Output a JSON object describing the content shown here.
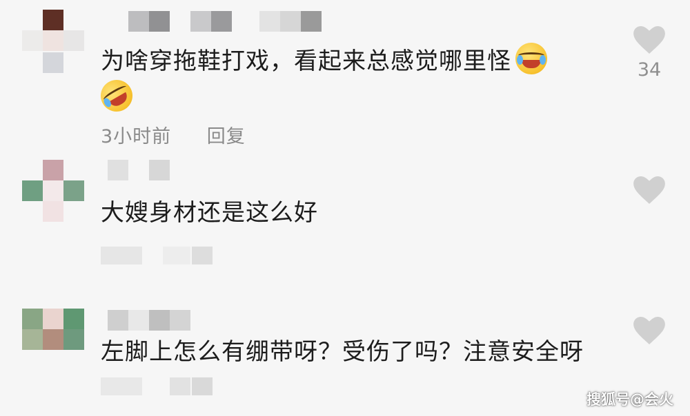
{
  "comments": [
    {
      "text": "为啥穿拖鞋打戏，看起来总感觉哪里怪",
      "time": "3小时前",
      "reply_label": "回复",
      "likes": "34",
      "emoji_icons": [
        "laughing-crying-emoji",
        "rolling-laughing-emoji"
      ]
    },
    {
      "text": "大嫂身材还是这么好",
      "likes": ""
    },
    {
      "text": "左脚上怎么有绷带呀？受伤了吗？注意安全呀",
      "likes": ""
    }
  ],
  "colors": {
    "background": "#f6f6f6",
    "text": "#1c1c1c",
    "meta": "#8a8a8a",
    "heart": "#d0d0d0"
  },
  "watermark": "搜狐号@会火"
}
